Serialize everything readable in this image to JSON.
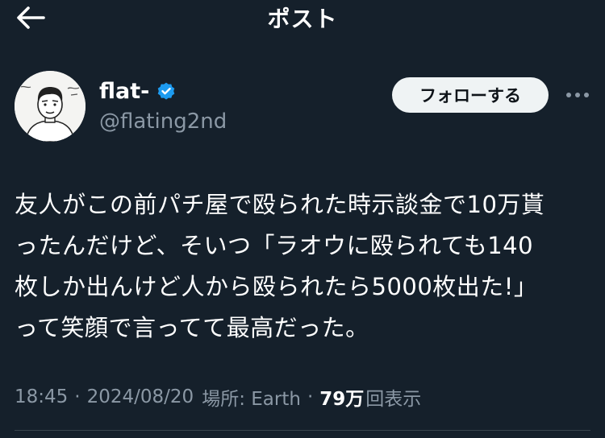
{
  "header": {
    "title": "ポスト"
  },
  "author": {
    "display_name": "flat-",
    "handle": "@flating2nd",
    "verified": true,
    "verified_color": "#1d9bf0",
    "follow_label": "フォローする"
  },
  "tweet": {
    "text": "友人がこの前パチ屋で殴られた時示談金で10万貰\nったんだけど、そいつ「ラオウに殴られても140\n枚しか出んけど人から殴られたら5000枚出た!」\nって笑顔で言ってて最高だった。"
  },
  "meta": {
    "time": "18:45",
    "date": "2024/08/20",
    "location_label": "場所: Earth",
    "views_count": "79万",
    "views_label": "回表示"
  },
  "icons": {
    "back": "arrow-left-icon",
    "verified": "verified-badge-icon",
    "more": "more-horizontal-icon"
  },
  "colors": {
    "background": "#15202b",
    "secondary_text": "#8b98a5",
    "follow_button_bg": "#eff3f4"
  }
}
